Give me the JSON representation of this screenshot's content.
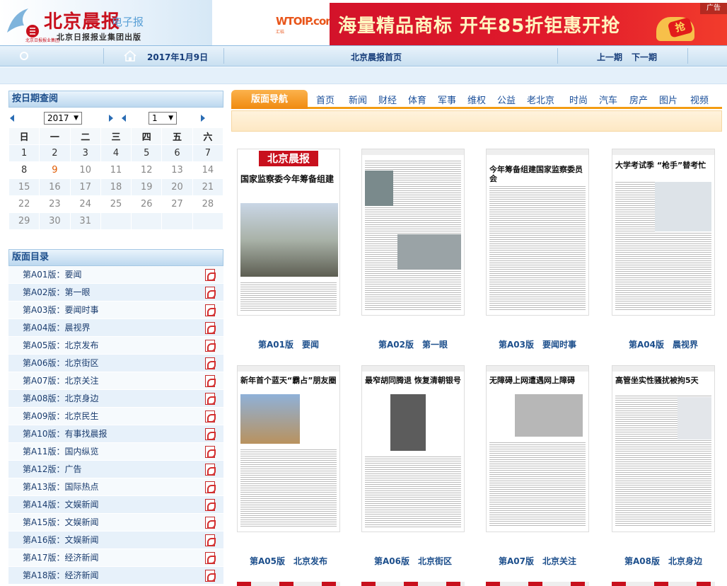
{
  "header": {
    "logo_title": "北京晨报",
    "logo_sub": "电子报",
    "logo_group": "北京日报报业集团出版",
    "logo_small": "北京日报报业集团",
    "ad_brand": "WTOIP.com",
    "ad_brand_sub": "汇桔",
    "ad_text": "海量精品商标 开年85折钜惠开抢",
    "ad_badge": "广告",
    "ad_coin": "抢"
  },
  "navbar": {
    "date": "2017年1月9日",
    "home": "北京晨报首页",
    "prev": "上一期",
    "next": "下一期"
  },
  "calendar": {
    "title": "按日期查阅",
    "year": "2017",
    "month": "1",
    "weekdays": [
      "日",
      "一",
      "二",
      "三",
      "四",
      "五",
      "六"
    ],
    "weeks": [
      [
        "1",
        "2",
        "3",
        "4",
        "5",
        "6",
        "7"
      ],
      [
        "8",
        "9",
        "10",
        "11",
        "12",
        "13",
        "14"
      ],
      [
        "15",
        "16",
        "17",
        "18",
        "19",
        "20",
        "21"
      ],
      [
        "22",
        "23",
        "24",
        "25",
        "26",
        "27",
        "28"
      ],
      [
        "29",
        "30",
        "31",
        "",
        "",
        "",
        ""
      ]
    ]
  },
  "pagelist": {
    "title": "版面目录",
    "items": [
      "第A01版：要闻",
      "第A02版：第一眼",
      "第A03版：要闻时事",
      "第A04版：晨视界",
      "第A05版：北京发布",
      "第A06版：北京街区",
      "第A07版：北京关注",
      "第A08版：北京身边",
      "第A09版：北京民生",
      "第A10版：有事找晨报",
      "第A11版：国内纵览",
      "第A12版：广告",
      "第A13版：国际热点",
      "第A14版：文娱新闻",
      "第A15版：文娱新闻",
      "第A16版：文娱新闻",
      "第A17版：经济新闻",
      "第A18版：经济新闻"
    ]
  },
  "tabs": {
    "active": "版面导航",
    "items": [
      "首页",
      "新闻",
      "财经",
      "体育",
      "军事",
      "维权",
      "公益",
      "老北京",
      "时尚",
      "汽车",
      "房产",
      "图片",
      "视频"
    ]
  },
  "thumbs": [
    {
      "headline": "国家监察委今年筹备组建",
      "caption": "第A01版　要闻",
      "masthead": "北京晨报"
    },
    {
      "headline": "",
      "caption": "第A02版　第一眼"
    },
    {
      "headline": "今年筹备组建国家监察委员会",
      "caption": "第A03版　要闻时事"
    },
    {
      "headline": "大学考试季 “枪手”替考忙",
      "caption": "第A04版　晨视界"
    },
    {
      "headline": "新年首个蓝天“霸占”朋友圈",
      "caption": "第A05版　北京发布"
    },
    {
      "headline": "最窄胡同腾退 恢复清朝银号",
      "caption": "第A06版　北京街区"
    },
    {
      "headline": "无障碍上网遭遇网上障碍",
      "caption": "第A07版　北京关注"
    },
    {
      "headline": "高管坐实性骚扰被拘5天",
      "caption": "第A08版　北京身边"
    }
  ]
}
